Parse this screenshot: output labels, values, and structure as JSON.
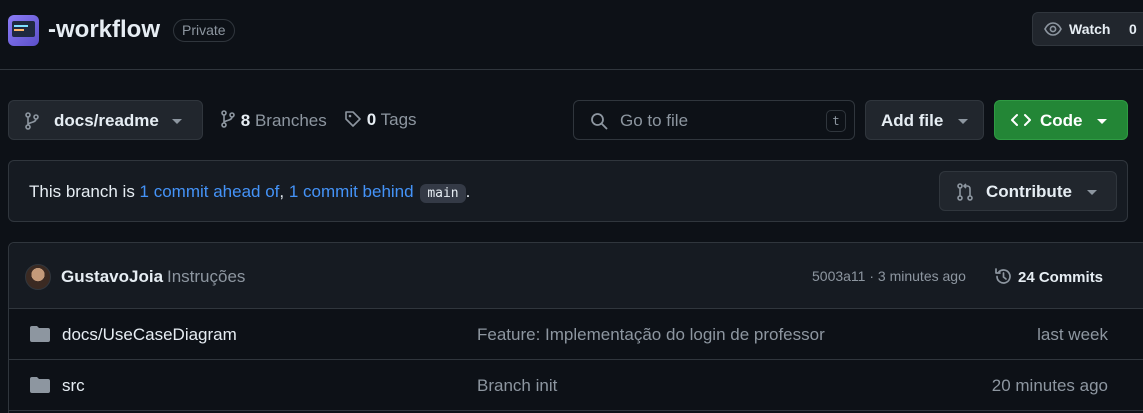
{
  "repo": {
    "name": "-workflow",
    "visibility": "Private",
    "watch_label": "Watch",
    "watch_count": "0"
  },
  "toolbar": {
    "branch": "docs/readme",
    "branches_count": "8",
    "branches_label": "Branches",
    "tags_count": "0",
    "tags_label": "Tags",
    "search_placeholder": "Go to file",
    "search_shortcut": "t",
    "add_file_label": "Add file",
    "code_label": "Code"
  },
  "branch_info": {
    "prefix": "This branch is ",
    "ahead": "1 commit ahead of",
    "comma": ", ",
    "behind": "1 commit behind",
    "base_branch": "main",
    "suffix": ".",
    "contribute_label": "Contribute"
  },
  "latest_commit": {
    "author": "GustavoJoia",
    "message": "Instruções",
    "meta": "5003a11 · 3 minutes ago",
    "commits_label": "24 Commits"
  },
  "files": [
    {
      "name": "docs/UseCaseDiagram",
      "message": "Feature: Implementação do login de professor",
      "age": "last week"
    },
    {
      "name": "src",
      "message": "Branch init",
      "age": "20 minutes ago"
    }
  ],
  "colors": {
    "background": "#0d1117",
    "link": "#4493f8",
    "code_button": "#238636",
    "border": "#30363d"
  }
}
